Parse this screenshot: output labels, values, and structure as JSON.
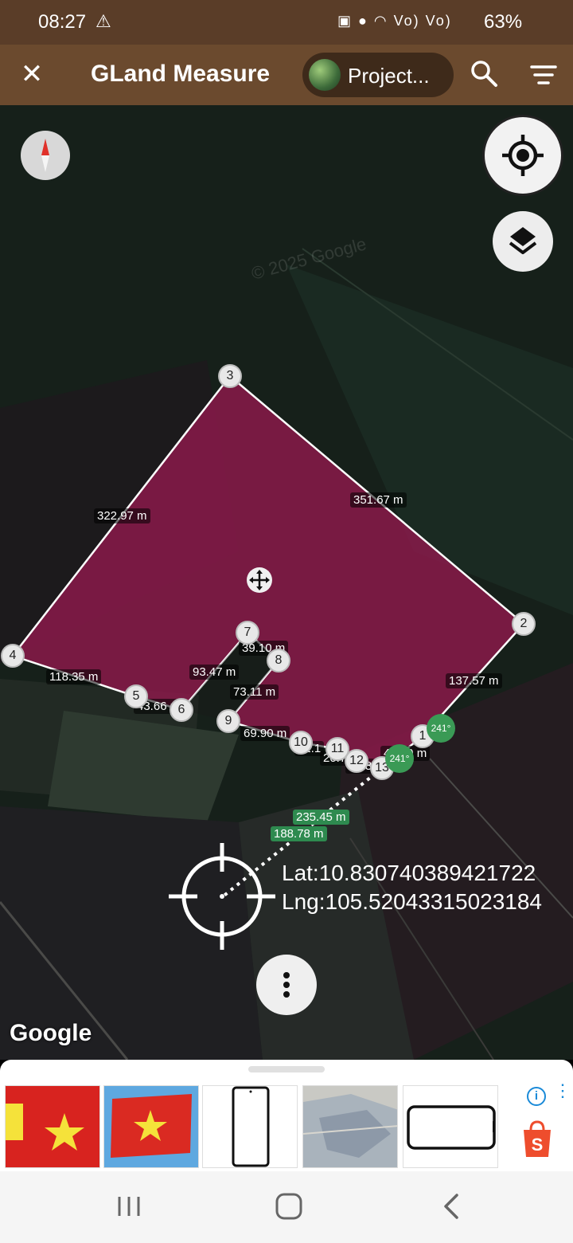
{
  "status_bar": {
    "time": "08:27",
    "warning_icon": "warning-icon",
    "signal_text": "Vo) Vo)",
    "battery": "63%"
  },
  "app_bar": {
    "title": "GLand Measure",
    "project_label": "Project..."
  },
  "map": {
    "watermark": "© 2025 Google",
    "segment_labels": {
      "s1": "351.67 m",
      "s2": "322.97 m",
      "s3": "137.57 m",
      "s4": "118.35 m",
      "s5": "39.10 m",
      "s6": "93.47 m",
      "s7": "73.11 m",
      "s8": "43.66 m",
      "s9": "69.90 m",
      "s10": "32.1",
      "s11": "20.7",
      "s12": "25.8",
      "s13": "46.69 m",
      "s14": "235.45 m",
      "s15": "188.78 m"
    },
    "vertices": [
      "1",
      "2",
      "3",
      "4",
      "5",
      "6",
      "7",
      "8",
      "9",
      "10",
      "11",
      "12",
      "13"
    ],
    "angles": {
      "a1": "241°",
      "a2": "241°"
    },
    "coordinates": {
      "lat": "Lat:10.830740389421722",
      "lng": "Lng:105.52043315023184"
    },
    "google_logo": "Google",
    "polygon_color": "#8a1a4a"
  },
  "ad_strip": {
    "items": [
      "vietnam-flag-shirt",
      "vietnam-flag",
      "phone-screen-protector",
      "satellite-map",
      "phone-case"
    ],
    "info_label": "i",
    "shop_label": "S"
  },
  "nav_bar": {
    "recent_icon": "recent-apps-icon",
    "home_icon": "home-icon",
    "back_icon": "back-icon"
  }
}
